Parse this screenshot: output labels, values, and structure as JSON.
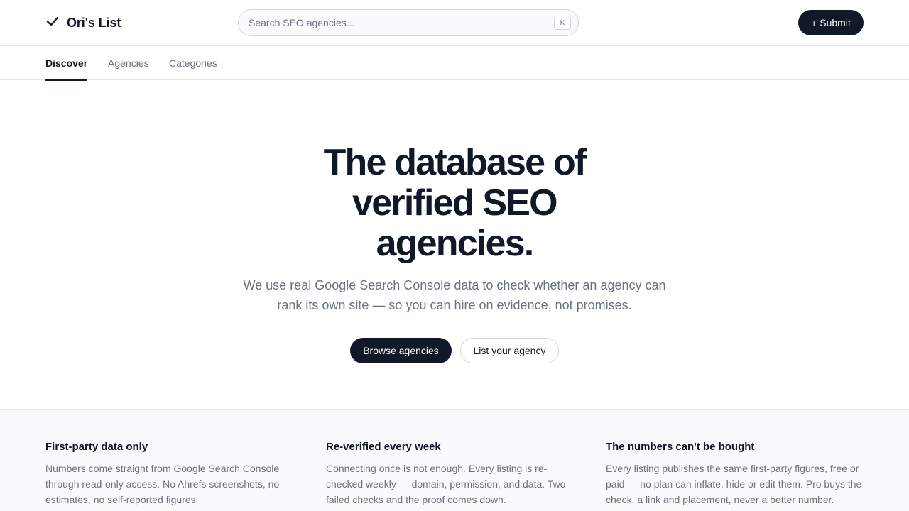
{
  "header": {
    "brand": "Ori's List",
    "brand_icon": "check-icon",
    "search_placeholder": "Search SEO agencies...",
    "search_shortcut": "K",
    "submit_label": "+ Submit"
  },
  "tabs": [
    {
      "label": "Discover",
      "active": true
    },
    {
      "label": "Agencies",
      "active": false
    },
    {
      "label": "Categories",
      "active": false
    }
  ],
  "hero": {
    "title": "The database of verified SEO agencies.",
    "subtitle": "We use real Google Search Console data to check whether an agency can rank its own site — so you can hire on evidence, not promises.",
    "primary_cta": "Browse agencies",
    "secondary_cta": "List your agency"
  },
  "features": [
    {
      "title": "First-party data only",
      "body": "Numbers come straight from Google Search Console through read-only access. No Ahrefs screenshots, no estimates, no self-reported figures."
    },
    {
      "title": "Re-verified every week",
      "body": "Connecting once is not enough. Every listing is re-checked weekly — domain, permission, and data. Two failed checks and the proof comes down."
    },
    {
      "title": "The numbers can't be bought",
      "body": "Every listing publishes the same first-party figures, free or paid — no plan can inflate, hide or edit them. Pro buys the check, a link and placement, never a better number."
    }
  ],
  "colors": {
    "primary": "#111827",
    "muted": "#6b7280",
    "border": "#e5e7eb",
    "section_bg": "#f9fafb"
  }
}
